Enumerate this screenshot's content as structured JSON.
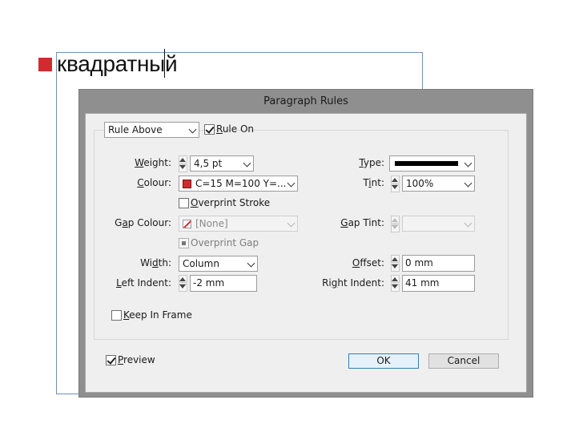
{
  "document": {
    "text": "квадратный",
    "bullet_color": "#d12b2f"
  },
  "dialog": {
    "title": "Paragraph Rules",
    "rule_type": {
      "value": "Rule Above"
    },
    "rule_on": {
      "label_pre": "",
      "label_ul": "R",
      "label_post": "ule On",
      "checked": true
    },
    "weight": {
      "label_pre": "",
      "label_ul": "W",
      "label_post": "eight:",
      "value": "4,5 pt"
    },
    "colour": {
      "label_pre": "",
      "label_ul": "C",
      "label_post": "olour:",
      "value": "C=15 M=100 Y=...",
      "swatch": "#d12b2f"
    },
    "overprint_stroke": {
      "label_pre": "",
      "label_ul": "O",
      "label_post": "verprint Stroke",
      "checked": false
    },
    "gap_colour": {
      "label_pre": "G",
      "label_ul": "a",
      "label_post": "p Colour:",
      "value": "[None]"
    },
    "overprint_gap": {
      "label": "Overprint Gap"
    },
    "width": {
      "label_pre": "Wi",
      "label_ul": "d",
      "label_post": "th:",
      "value": "Column"
    },
    "left_indent": {
      "label_pre": "",
      "label_ul": "L",
      "label_post": "eft Indent:",
      "value": "-2 mm"
    },
    "type": {
      "label_pre": "",
      "label_ul": "T",
      "label_post": "ype:"
    },
    "tint": {
      "label_pre": "T",
      "label_ul": "i",
      "label_post": "nt:",
      "value": "100%"
    },
    "gap_tint": {
      "label_pre": "",
      "label_ul": "G",
      "label_post": "ap Tint:"
    },
    "offset": {
      "label_pre": "",
      "label_ul": "O",
      "label_post": "ffset:",
      "value": "0 mm"
    },
    "right_indent": {
      "label_pre": "Ri",
      "label_ul": "g",
      "label_post": "ht Indent:",
      "value": "41 mm"
    },
    "keep_in_frame": {
      "label_pre": "",
      "label_ul": "K",
      "label_post": "eep In Frame",
      "checked": false
    },
    "preview": {
      "label_pre": "",
      "label_ul": "P",
      "label_post": "review",
      "checked": true
    },
    "ok_label": "OK",
    "cancel_label": "Cancel"
  }
}
